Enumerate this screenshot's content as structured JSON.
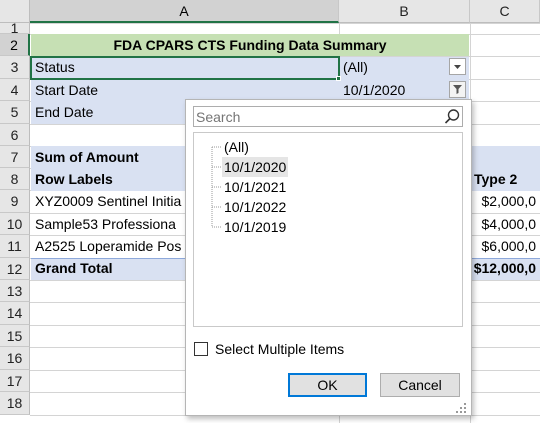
{
  "columns": [
    "A",
    "B",
    "C"
  ],
  "rows": [
    "1",
    "2",
    "3",
    "4",
    "5",
    "6",
    "7",
    "8",
    "9",
    "10",
    "11",
    "12",
    "13",
    "14",
    "15",
    "16",
    "17",
    "18"
  ],
  "sheet": {
    "title": "FDA CPARS CTS Funding Data Summary",
    "filters": [
      {
        "label": "Status",
        "value": "(All)"
      },
      {
        "label": "Start Date",
        "value": "10/1/2020"
      },
      {
        "label": "End Date",
        "value": ""
      }
    ],
    "sum_label": "Sum of Amount",
    "row_labels_header": "Row Labels",
    "type2_header": "Type 2",
    "data_rows": [
      {
        "label": "XYZ0009 Sentinel Initia",
        "type2": "$2,000,0"
      },
      {
        "label": "Sample53 Professiona",
        "type2": "$4,000,0"
      },
      {
        "label": "A2525 Loperamide Pos",
        "type2": "$6,000,0"
      }
    ],
    "grand_total_label": "Grand Total",
    "grand_total_value": "$12,000,0"
  },
  "popup": {
    "search_placeholder": "Search",
    "items": [
      "(All)",
      "10/1/2020",
      "10/1/2021",
      "10/1/2022",
      "10/1/2019"
    ],
    "selected_item": "10/1/2020",
    "select_multiple_label": "Select Multiple Items",
    "select_multiple_checked": false,
    "ok_label": "OK",
    "cancel_label": "Cancel"
  },
  "colors": {
    "title_fill": "#c6e0b4",
    "filter_fill": "#d9e1f2",
    "selection_green": "#217346"
  },
  "icons": [
    "filter-dropdown-icon",
    "filter-active-icon",
    "search-icon",
    "resize-grip-icon"
  ]
}
